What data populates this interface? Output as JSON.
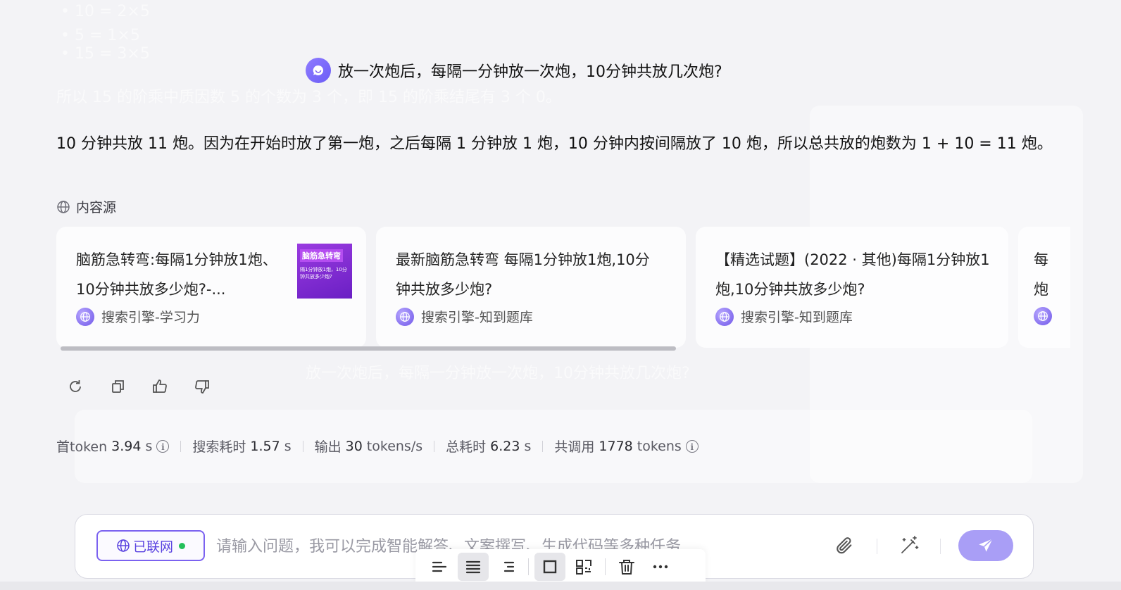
{
  "question": {
    "text": "放一次炮后，每隔一分钟放一次炮，10分钟共放几次炮?"
  },
  "answer": {
    "text": "10 分钟共放 11 炮。因为在开始时放了第一炮，之后每隔 1 分钟放 1 炮，10 分钟内按间隔放了 10 炮，所以总共放的炮数为 1 + 10 = 11 炮。"
  },
  "sources": {
    "label": "内容源",
    "cards": [
      {
        "title": "脑筋急转弯:每隔1分钟放1炮、10分钟共放多少炮?-...",
        "source": "搜索引擎-学习力",
        "thumb_title": "脑筋急转弯",
        "thumb_text": "隔1分钟放1炮，10分钟共放多少炮?"
      },
      {
        "title": "最新脑筋急转弯 每隔1分钟放1炮,10分钟共放多少炮?",
        "source": "搜索引擎-知到题库"
      },
      {
        "title": "【精选试题】(2022 · 其他)每隔1分钟放1炮,10分钟共放多少炮?",
        "source": "搜索引擎-知到题库"
      },
      {
        "title": "每 炮",
        "source": ""
      }
    ]
  },
  "actions": [
    "refresh-icon",
    "copy-icon",
    "thumbs-up-icon",
    "thumbs-down-icon"
  ],
  "stats": {
    "first_token_label": "首token",
    "first_token_value": "3.94",
    "first_token_unit": "s",
    "search_label": "搜索耗时",
    "search_value": "1.57",
    "search_unit": "s",
    "output_label": "输出",
    "output_value": "30",
    "output_unit": "tokens/s",
    "total_label": "总耗时",
    "total_value": "6.23",
    "total_unit": "s",
    "calls_label": "共调用",
    "calls_value": "1778",
    "calls_unit": "tokens"
  },
  "input": {
    "network_label": "已联网",
    "placeholder": "请输入问题，我可以完成智能解答、文案撰写、生成代码等多种任务..."
  },
  "toolbar": [
    "align-left-icon",
    "align-center-icon",
    "align-right-icon",
    "frame-icon",
    "qr-scan-icon",
    "delete-icon",
    "more-icon"
  ],
  "colors": {
    "accent": "#7b62f0",
    "send_button": "#a99ef6",
    "online_dot": "#24c05a"
  }
}
